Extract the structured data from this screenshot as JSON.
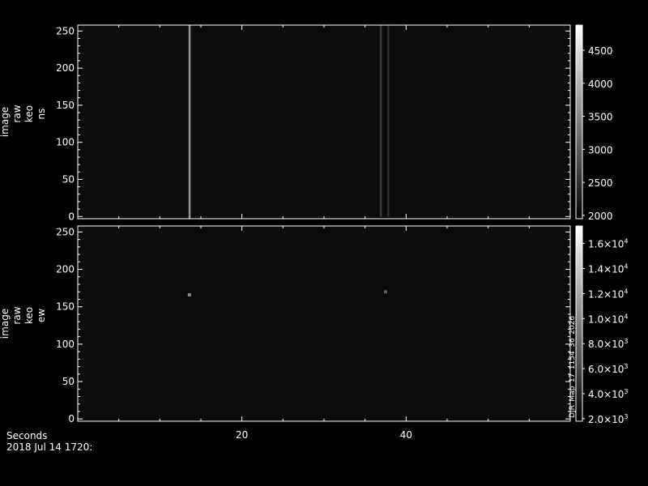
{
  "footer": {
    "xlabel": "Seconds",
    "date": "2018 Jul 14 1720:"
  },
  "chart_data": [
    {
      "type": "heatmap",
      "ylabel": [
        "image",
        "raw",
        "keo",
        "ns"
      ],
      "xlim": [
        0,
        60
      ],
      "ylim": [
        -3,
        258
      ],
      "xticks": [
        {
          "v": 20,
          "label": "20"
        },
        {
          "v": 40,
          "label": "40"
        }
      ],
      "yticks": [
        {
          "v": 0,
          "label": "0"
        },
        {
          "v": 50,
          "label": "50"
        },
        {
          "v": 100,
          "label": "100"
        },
        {
          "v": 150,
          "label": "150"
        },
        {
          "v": 200,
          "label": "200"
        },
        {
          "v": 250,
          "label": "250"
        }
      ],
      "colorbar": {
        "min": 1950,
        "max": 4880,
        "ticks": [
          {
            "v": 2000,
            "label": "2000"
          },
          {
            "v": 2500,
            "label": "2500"
          },
          {
            "v": 3000,
            "label": "3000"
          },
          {
            "v": 3500,
            "label": "3500"
          },
          {
            "v": 4000,
            "label": "4000"
          },
          {
            "v": 4500,
            "label": "4500"
          }
        ]
      },
      "features": [
        {
          "x": 13.6,
          "y0": -3,
          "y1": 258,
          "level": 0.55
        },
        {
          "x": 36.9,
          "y0": 0,
          "y1": 258,
          "level": 0.16
        },
        {
          "x": 37.8,
          "y0": 0,
          "y1": 258,
          "level": 0.12
        }
      ]
    },
    {
      "type": "heatmap",
      "ylabel": [
        "image",
        "raw",
        "keo",
        "ew"
      ],
      "xlim": [
        0,
        60
      ],
      "ylim": [
        -3,
        258
      ],
      "xticks": [
        {
          "v": 20,
          "label": "20"
        },
        {
          "v": 40,
          "label": "40"
        }
      ],
      "yticks": [
        {
          "v": 0,
          "label": "0"
        },
        {
          "v": 50,
          "label": "50"
        },
        {
          "v": 100,
          "label": "100"
        },
        {
          "v": 150,
          "label": "150"
        },
        {
          "v": 200,
          "label": "200"
        },
        {
          "v": 250,
          "label": "250"
        }
      ],
      "colorbar": {
        "min": 1800,
        "max": 17400,
        "ticks": [
          {
            "v": 2000,
            "mant": "2.0",
            "exp": "3"
          },
          {
            "v": 4000,
            "mant": "4.0",
            "exp": "3"
          },
          {
            "v": 6000,
            "mant": "6.0",
            "exp": "3"
          },
          {
            "v": 8000,
            "mant": "8.0",
            "exp": "3"
          },
          {
            "v": 10000,
            "mant": "1.0",
            "exp": "4"
          },
          {
            "v": 12000,
            "mant": "1.2",
            "exp": "4"
          },
          {
            "v": 14000,
            "mant": "1.4",
            "exp": "4"
          },
          {
            "v": 16000,
            "mant": "1.6",
            "exp": "4"
          }
        ],
        "side_text": "DJR_Map_17_1154_36_2026"
      },
      "features": [
        {
          "x": 13.6,
          "y": 166,
          "level": 0.5
        },
        {
          "x": 37.5,
          "y": 170,
          "level": 0.3
        }
      ]
    }
  ]
}
